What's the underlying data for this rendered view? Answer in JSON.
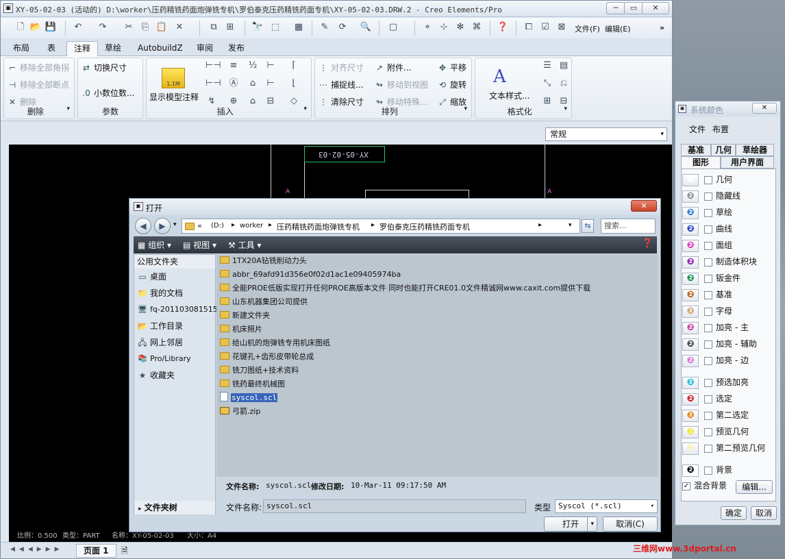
{
  "window": {
    "title": "XY-05-02-03 (活动的) D:\\worker\\压药精铣药面炮弹铣专机\\罗伯泰克压药精铣药面专机\\XY-05-02-03.DRW.2 - Creo Elements/Pro"
  },
  "qat": {
    "file_menu": "文件(F)",
    "edit_menu": "编辑(E)"
  },
  "tabs": [
    "布局",
    "表",
    "注释",
    "草绘",
    "AutobuildZ",
    "审阅",
    "发布"
  ],
  "ribbon": {
    "delete": {
      "label": "删除",
      "items": [
        "移除全部角拐",
        "移除全部断点",
        "删除"
      ]
    },
    "params": {
      "label": "参数",
      "items": [
        "切换尺寸",
        "小数位数..."
      ]
    },
    "insert": {
      "label": "插入",
      "show_model_annot": "显示模型注释"
    },
    "arrange": {
      "label": "排列",
      "items": [
        "对齐尺寸",
        "附件...",
        "平移",
        "捕捉线...",
        "移动到视图",
        "旋转",
        "清除尺寸",
        "移动特殊...",
        "缩放"
      ]
    },
    "format": {
      "label": "格式化",
      "text_style": "文本样式..."
    }
  },
  "drawing": {
    "combo_value": "常规",
    "title_text": "XY-05-02-03",
    "marker": "A",
    "status_scale": "比例：0.500",
    "status_type": "类型：PART",
    "status_name": "名称：XY-05-02-03",
    "status_size": "大小：A4",
    "page_tab": "页面 1"
  },
  "open_dialog": {
    "title": "打开",
    "path": [
      "(D:)",
      "worker",
      "压药精铣药面炮弹铣专机",
      "罗伯泰克压药精铣药面专机"
    ],
    "search_placeholder": "搜索...",
    "toolbar": [
      "组织",
      "视图",
      "工具"
    ],
    "sidebar_header": "公用文件夹",
    "sidebar": [
      "桌面",
      "我的文档",
      "fq-201103081515",
      "工作目录",
      "网上邻居",
      "Pro/Library",
      "收藏夹"
    ],
    "folder_tree": "文件夹树",
    "files": [
      {
        "name": "1TX20A钻铣削动力头",
        "kind": "folder"
      },
      {
        "name": "abbr_69afd91d356e0f02d1ac1e09405974ba",
        "kind": "folder"
      },
      {
        "name": "全能PROE低版实现打开任何PROE高版本文件 同时也能打开CRE01.0文件精诚网www.caxit.com提供下载",
        "kind": "folder"
      },
      {
        "name": "山东机器集团公司提供",
        "kind": "folder"
      },
      {
        "name": "新建文件夹",
        "kind": "folder"
      },
      {
        "name": "机床照片",
        "kind": "folder"
      },
      {
        "name": "给山机的炮弹铣专用机床图纸",
        "kind": "folder"
      },
      {
        "name": "花键孔+齿形皮带轮总成",
        "kind": "folder"
      },
      {
        "name": "铣刀图纸+技术资料",
        "kind": "folder"
      },
      {
        "name": "铣药最终机械图",
        "kind": "folder"
      },
      {
        "name": "syscol.scl",
        "kind": "file",
        "selected": true
      },
      {
        "name": "弓箭.zip",
        "kind": "zip"
      }
    ],
    "details_name_label": "文件名称:",
    "details_name": "syscol.scl",
    "details_date_label": "修改日期:",
    "details_date": "10-Mar-11 09:17:50 AM",
    "filename_label": "文件名称:",
    "filename_value": "syscol.scl",
    "type_label": "类型",
    "type_value": "Syscol (*.scl)",
    "open_btn": "打开",
    "cancel_btn": "取消(C)"
  },
  "color_panel": {
    "title": "系统颜色",
    "menu": [
      "文件",
      "布置"
    ],
    "tabs_row1": [
      "基准",
      "几何",
      "草绘器"
    ],
    "tabs_row2": [
      "图形",
      "用户界面"
    ],
    "items": [
      {
        "label": "几何",
        "color": "#ffffff"
      },
      {
        "label": "隐藏线",
        "color": "#8a8f96"
      },
      {
        "label": "草绘",
        "color": "#2d7fd6"
      },
      {
        "label": "曲线",
        "color": "#2a3fd0"
      },
      {
        "label": "面组",
        "color": "#e03cb8"
      },
      {
        "label": "制造体积块",
        "color": "#8a1fb0"
      },
      {
        "label": "钣金件",
        "color": "#14924a"
      },
      {
        "label": "基准",
        "color": "#b8651c"
      },
      {
        "label": "字母",
        "color": "#c9a46a"
      },
      {
        "label": "加亮 - 主",
        "color": "#cf3ea8"
      },
      {
        "label": "加亮 - 辅助",
        "color": "#444444"
      },
      {
        "label": "加亮 - 边",
        "color": "#e070d8"
      },
      {
        "label": "预选加亮",
        "color": "#21bcd9"
      },
      {
        "label": "选定",
        "color": "#d41b28"
      },
      {
        "label": "第二选定",
        "color": "#ee7c12"
      },
      {
        "label": "预览几何",
        "color": "#f2e81c"
      },
      {
        "label": "第二预览几何",
        "color": "#f6f0b8"
      },
      {
        "label": "背景",
        "color": "#000000"
      }
    ],
    "blend_bg": "混合背景",
    "edit_btn": "编辑...",
    "ok_btn": "确定",
    "cancel_btn": "取消"
  },
  "watermark": "三维网www.3dportal.cn"
}
